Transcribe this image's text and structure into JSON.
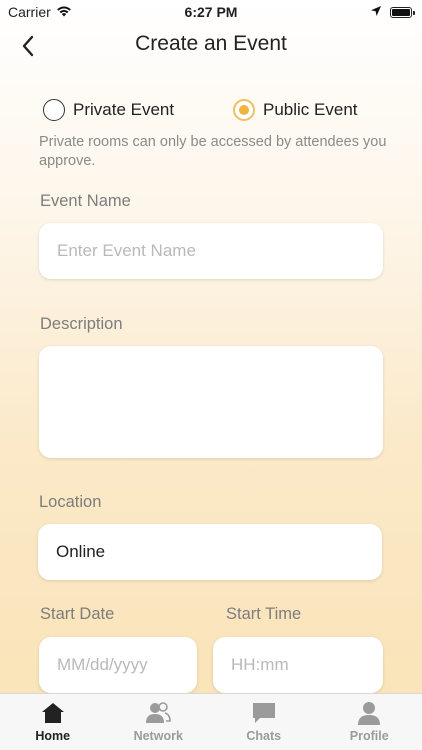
{
  "status_bar": {
    "carrier": "Carrier",
    "time": "6:27 PM"
  },
  "nav": {
    "title": "Create an Event"
  },
  "event_type": {
    "options": [
      {
        "label": "Private Event",
        "selected": false
      },
      {
        "label": "Public Event",
        "selected": true
      }
    ],
    "note": "Private rooms can only be accessed by attendees you approve."
  },
  "form": {
    "event_name": {
      "label": "Event Name",
      "placeholder": "Enter Event Name"
    },
    "description": {
      "label": "Description",
      "value": ""
    },
    "location": {
      "label": "Location",
      "value": "Online"
    },
    "start_date": {
      "label": "Start Date",
      "placeholder": "MM/dd/yyyy"
    },
    "start_time": {
      "label": "Start Time",
      "placeholder": "HH:mm"
    }
  },
  "tabs": [
    {
      "label": "Home",
      "icon": "home-icon",
      "active": true
    },
    {
      "label": "Network",
      "icon": "network-icon",
      "active": false
    },
    {
      "label": "Chats",
      "icon": "chat-icon",
      "active": false
    },
    {
      "label": "Profile",
      "icon": "profile-icon",
      "active": false
    }
  ],
  "colors": {
    "accent": "#efb53f",
    "inactive_tab": "#9b9b9b"
  }
}
